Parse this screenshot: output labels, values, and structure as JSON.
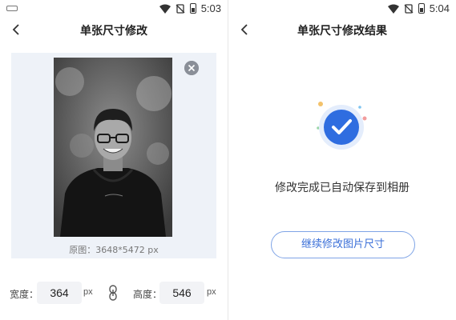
{
  "colors": {
    "accent": "#2f6de0",
    "preview_bg": "#eef2f8",
    "field_bg": "#f2f3f6"
  },
  "left": {
    "status": {
      "time": "5:03"
    },
    "header": {
      "title": "单张尺寸修改"
    },
    "preview": {
      "original_label": "原图：3648*5472 px"
    },
    "size": {
      "width_label": "宽度：",
      "width_value": "364",
      "width_unit": "px",
      "height_label": "高度：",
      "height_value": "546",
      "height_unit": "px"
    }
  },
  "right": {
    "status": {
      "time": "5:04"
    },
    "header": {
      "title": "单张尺寸修改结果"
    },
    "result": {
      "message": "修改完成已自动保存到相册"
    },
    "continue_label": "继续修改图片尺寸"
  }
}
